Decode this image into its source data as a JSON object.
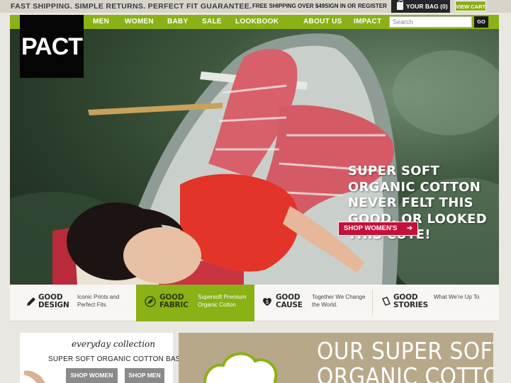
{
  "topbar": {
    "promo": "FAST SHIPPING. SIMPLE RETURNS. PERFECT FIT GUARANTEE.",
    "shipping": "FREE SHIPPING OVER $49",
    "sign_in": "SIGN IN",
    "or": "OR",
    "register": "REGISTER",
    "bag": "YOUR BAG (0)",
    "view_cart": "VIEW CART"
  },
  "brand": {
    "logo": "PACT",
    "accent": "#8ab115",
    "red": "#c5103a"
  },
  "nav": {
    "items": [
      "MEN",
      "WOMEN",
      "BABY",
      "SALE",
      "LOOKBOOK",
      "ABOUT US",
      "IMPACT"
    ],
    "search_placeholder": "Search",
    "go": "GO"
  },
  "hero": {
    "headline_lines": [
      "SUPER SOFT",
      "ORGANIC COTTON",
      "NEVER FELT THIS",
      "GOOD, OR LOOKED",
      "THIS CUTE!"
    ],
    "cta": "SHOP WOMEN'S",
    "cta_icon": "arrow-right-icon"
  },
  "features": [
    {
      "title1": "GOOD",
      "title2": "DESIGN",
      "desc1": "Iconic Prints and",
      "desc2": "Perfect Fits.",
      "icon": "pencil-icon",
      "active": false
    },
    {
      "title1": "GOOD",
      "title2": "FABRIC",
      "desc1": "Supersoft Premium",
      "desc2": "Organic Cotton",
      "icon": "leaf-icon",
      "active": true
    },
    {
      "title1": "GOOD",
      "title2": "CAUSE",
      "desc1": "Together We Change",
      "desc2": "the World.",
      "icon": "heart-dollar-icon",
      "active": false
    },
    {
      "title1": "GOOD",
      "title2": "STORIES",
      "desc1": "What We're Up To",
      "desc2": "",
      "icon": "book-icon",
      "active": false
    }
  ],
  "everyday": {
    "script": "everyday collection",
    "subtitle": "SUPER SOFT ORGANIC COTTON BASICS",
    "shop_women": "SHOP WOMEN",
    "shop_men": "SHOP MEN"
  },
  "promo2": {
    "line1": "OUR SUPER SOFT",
    "line2": "ORGANIC COTTON"
  }
}
